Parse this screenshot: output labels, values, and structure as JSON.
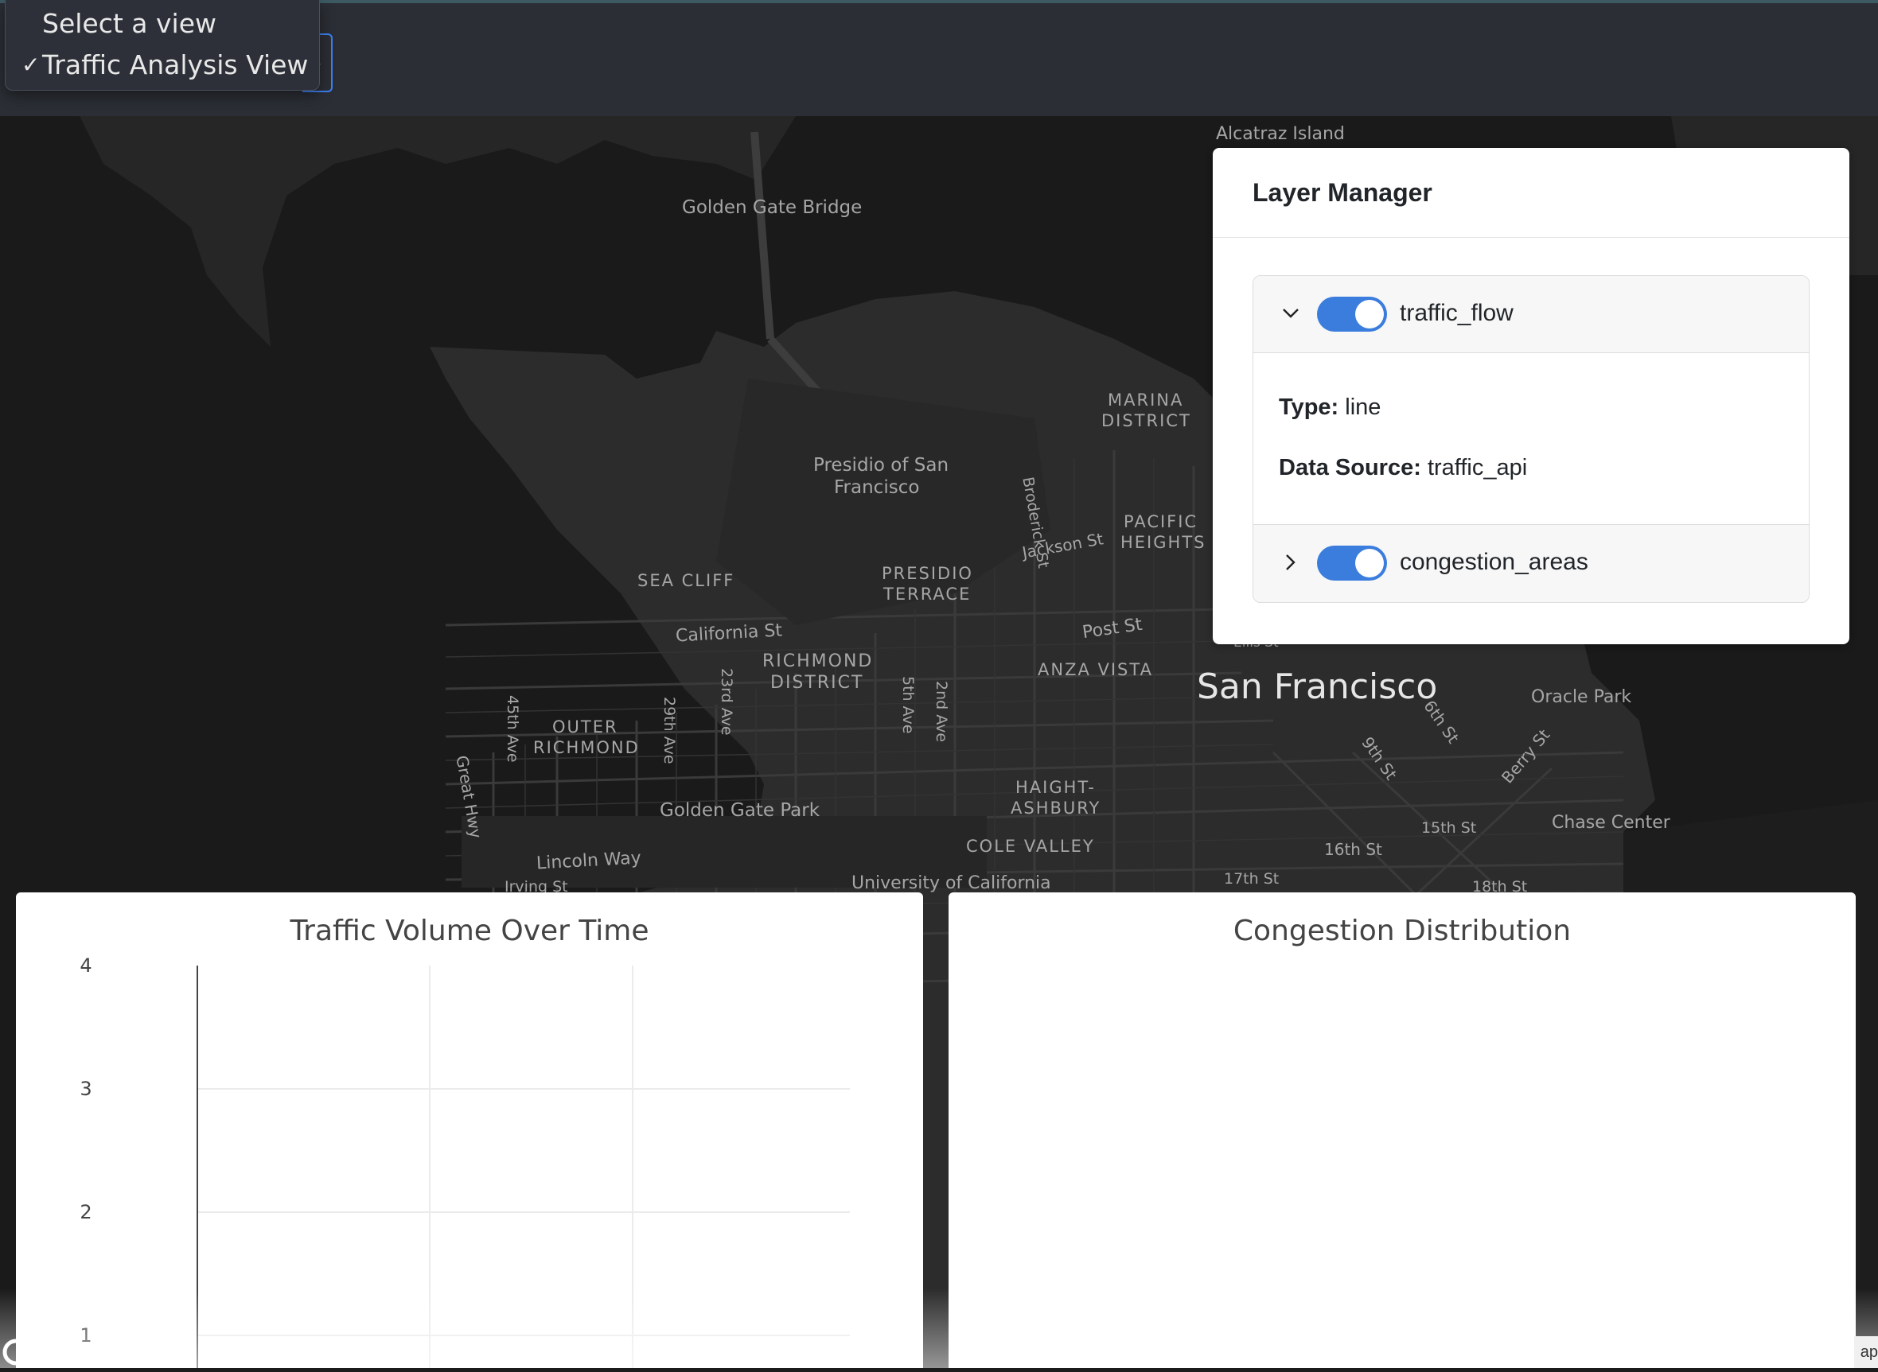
{
  "toolbar": {
    "view_dropdown": {
      "options": [
        "Select a view",
        "Traffic Analysis View"
      ],
      "selected": "Traffic Analysis View",
      "check": "✓"
    },
    "select_caret": "⌄"
  },
  "map": {
    "labels": [
      {
        "text": "Alcatraz Island"
      },
      {
        "text": "Golden Gate Bridge"
      },
      {
        "text": "MARINA"
      },
      {
        "text": "DISTRICT"
      },
      {
        "text": "Broderick St"
      },
      {
        "text": "Presidio of San"
      },
      {
        "text": "Francisco"
      },
      {
        "text": "PACIFIC"
      },
      {
        "text": "HEIGHTS"
      },
      {
        "text": "Jackson St"
      },
      {
        "text": "SEA CLIFF"
      },
      {
        "text": "PRESIDIO"
      },
      {
        "text": "TERRACE"
      },
      {
        "text": "California St"
      },
      {
        "text": "Post St"
      },
      {
        "text": "RICHMOND"
      },
      {
        "text": "DISTRICT"
      },
      {
        "text": "ANZA VISTA"
      },
      {
        "text": "San Francisco"
      },
      {
        "text": "Oracle Park"
      },
      {
        "text": "45th Ave"
      },
      {
        "text": "OUTER"
      },
      {
        "text": "RICHMOND"
      },
      {
        "text": "29th Ave"
      },
      {
        "text": "23rd Ave"
      },
      {
        "text": "5th Ave"
      },
      {
        "text": "2nd Ave"
      },
      {
        "text": "6th St"
      },
      {
        "text": "9th St"
      },
      {
        "text": "Berry St"
      },
      {
        "text": "Great Hwy"
      },
      {
        "text": "Golden Gate Park"
      },
      {
        "text": "HAIGHT-"
      },
      {
        "text": "ASHBURY"
      },
      {
        "text": "Chase Center"
      },
      {
        "text": "15th St"
      },
      {
        "text": "16th St"
      },
      {
        "text": "COLE VALLEY"
      },
      {
        "text": "Lincoln Way"
      },
      {
        "text": "Irving St"
      },
      {
        "text": "University of California"
      },
      {
        "text": "17th St"
      },
      {
        "text": "18th St"
      },
      {
        "text": "Ellis St"
      }
    ]
  },
  "layer_manager": {
    "title": "Layer Manager",
    "layers": [
      {
        "name": "traffic_flow",
        "enabled": true,
        "expanded": true,
        "type_label": "Type:",
        "type": "line",
        "source_label": "Data Source:",
        "source": "traffic_api"
      },
      {
        "name": "congestion_areas",
        "enabled": true,
        "expanded": false
      }
    ]
  },
  "charts": {
    "traffic_volume": {
      "title": "Traffic Volume Over Time"
    },
    "congestion": {
      "title": "Congestion Distribution"
    }
  },
  "chart_data": {
    "type": "line",
    "title": "Traffic Volume Over Time",
    "xlabel": "",
    "ylabel": "",
    "yticks": [
      1,
      2,
      3,
      4
    ],
    "ylim": [
      1,
      4
    ],
    "series": [],
    "grid": true
  },
  "footer": {
    "attribution": "ap"
  },
  "colors": {
    "accent": "#3b7ddd",
    "map_bg": "#1a1a1a",
    "toolbar": "#2b2e35"
  }
}
